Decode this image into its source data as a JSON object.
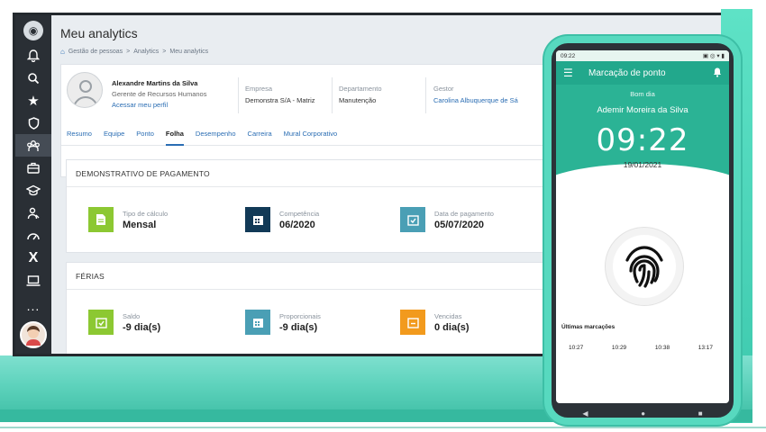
{
  "app": {
    "title": "Meu analytics"
  },
  "breadcrumb": [
    "Gestão de pessoas",
    ">",
    "Analytics",
    ">",
    "Meu analytics"
  ],
  "sidebar": {
    "items": [
      "home",
      "bell",
      "search",
      "star",
      "shield",
      "team",
      "briefcase",
      "graduation",
      "person",
      "gauge",
      "x",
      "laptop"
    ],
    "more": "..."
  },
  "profile": {
    "name": "Alexandre Martins da Silva",
    "role": "Gerente de Recursos Humanos",
    "link": "Acessar meu perfil",
    "empresa_label": "Empresa",
    "empresa": "Demonstra S/A - Matriz",
    "departamento_label": "Departamento",
    "departamento": "Manutenção",
    "gestor_label": "Gestor",
    "gestor": "Carolina Albuquerque de Sá"
  },
  "tabs": [
    "Resumo",
    "Equipe",
    "Ponto",
    "Folha",
    "Desempenho",
    "Carreira",
    "Mural Corporativo"
  ],
  "active_tab": "Folha",
  "pagamento": {
    "title": "DEMONSTRATIVO DE PAGAMENTO",
    "items": [
      {
        "label": "Tipo de cálculo",
        "value": "Mensal",
        "color": "#8cc832"
      },
      {
        "label": "Competência",
        "value": "06/2020",
        "color": "#123a57"
      },
      {
        "label": "Data de pagamento",
        "value": "05/07/2020",
        "color": "#4a9fb5"
      }
    ]
  },
  "ferias": {
    "title": "FÉRIAS",
    "items": [
      {
        "label": "Saldo",
        "value": "-9 dia(s)",
        "color": "#8cc832"
      },
      {
        "label": "Proporcionais",
        "value": "-9 dia(s)",
        "color": "#4a9fb5"
      },
      {
        "label": "Vencidas",
        "value": "0 dia(s)",
        "color": "#f29a1d"
      }
    ]
  },
  "phone": {
    "status_time": "09:22",
    "app_title": "Marcação de ponto",
    "greeting": "Bom dia",
    "user": "Ademir Moreira da Silva",
    "time": "09:22",
    "date": "19/01/2021",
    "last_title": "Últimas marcações",
    "marks": [
      "10:27",
      "10:29",
      "10:38",
      "13:17"
    ]
  }
}
